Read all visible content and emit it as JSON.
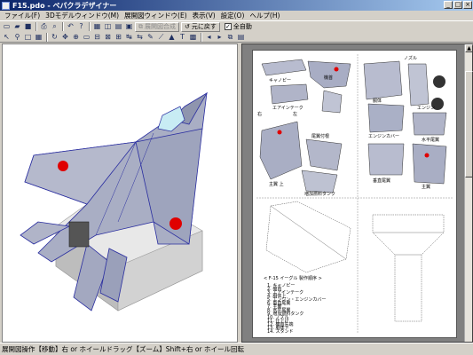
{
  "window": {
    "title": "F15.pdo - ペパクラデザイナー",
    "min": "_",
    "max": "□",
    "close": "×"
  },
  "menu": [
    "ファイル(F)",
    "3Dモデルウィンドウ(M)",
    "展開図ウィンドウ(E)",
    "表示(V)",
    "設定(O)",
    "ヘルプ(H)"
  ],
  "toolbar": {
    "merge_label": "展開図合成",
    "restore_label": "元に戻す",
    "auto_move_label": "全自動",
    "auto_move_checked": "✓"
  },
  "parts_labels": {
    "canopy": "キャノピー",
    "nozzle": "ノズル",
    "sensor": "機首",
    "intake": "エアインテーク",
    "engine": "エンジン",
    "stabilizer": "水平尾翼",
    "body_rear": "胴体",
    "engine_cover": "エンジンカバー",
    "vertical": "垂直尾翼",
    "r_mark": "右",
    "l_mark": "左",
    "wing_tip": "尾翼付根",
    "main_wing": "主翼 上",
    "wing_l": "主翼",
    "fuel_tank": "増加燃料タンク",
    "assembly_title": "< F-15 イーグル 製作順序 >",
    "steps": [
      "1. キャノピー",
      "2. 機首",
      "3. エアインテーク",
      "4. 胴体上",
      "5. エンジン・エンジンカバー",
      "6. 垂直尾翼",
      "7. 主翼",
      "8. 水平尾翼",
      "9. 増加燃料タンク",
      "10. ノズル",
      "11. 仕上げ",
      "12. 機首先端",
      "13. 胴体下",
      "14. スタンド"
    ]
  },
  "status": "展開図操作【移動】右 or ホイールドラッグ【ズーム】Shift+右 or ホイール回転"
}
